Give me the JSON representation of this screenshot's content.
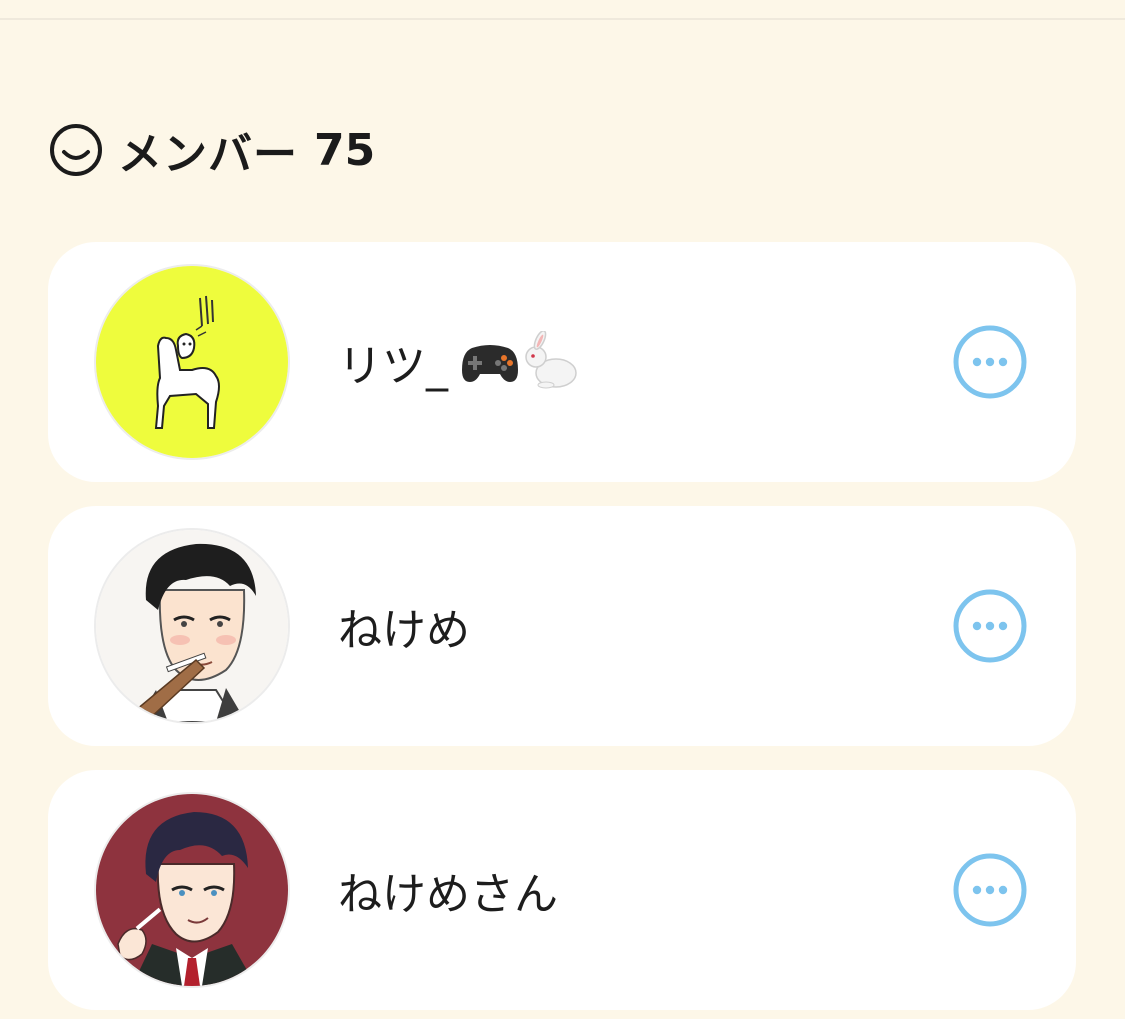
{
  "section": {
    "title": "メンバー",
    "count": "75",
    "icon": "smiley-face-icon"
  },
  "members": [
    {
      "name": "リツ_",
      "emojis": [
        "game-controller",
        "rabbit"
      ],
      "avatar": "yellow-alpaca-illustration"
    },
    {
      "name": "ねけめ",
      "avatar": "man-with-cigarette-illustration"
    },
    {
      "name": "ねけめさん",
      "avatar": "man-in-suit-red-background-illustration"
    }
  ],
  "colors": {
    "background": "#fdf7e8",
    "card": "#ffffff",
    "accent": "#7dc4ee",
    "text": "#1d1d1d"
  }
}
